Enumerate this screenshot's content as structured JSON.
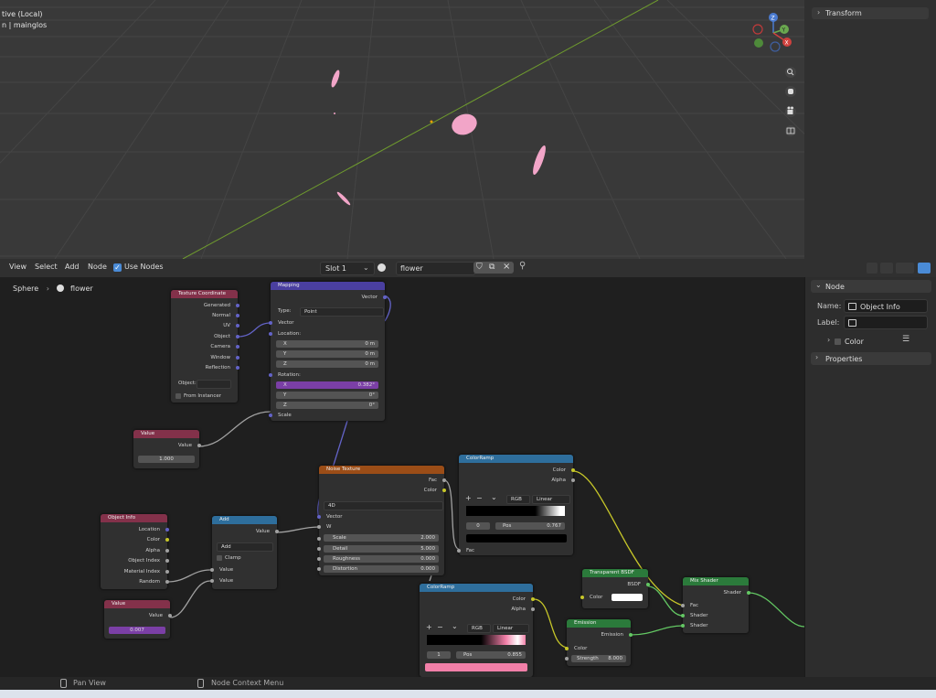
{
  "colors": {
    "grid_line": "#454545",
    "axis_green": "#6e9a2e",
    "petal": "#f2a5c8",
    "blue_sock": "#6363c7",
    "yellow_sock": "#c7c729",
    "gray_sock": "#a1a1a1",
    "green_sock": "#63c763",
    "purple_field": "#7b3fa6",
    "pink_ramp": "#f27fa8"
  },
  "viewport": {
    "mode_text": "tive (Local)",
    "object_text": "n | mainglos"
  },
  "right_panel_top": {
    "transform_label": "Transform"
  },
  "gizmo": {
    "z": "Z",
    "y": "Y",
    "x": "X"
  },
  "header": {
    "view": "View",
    "select": "Select",
    "add": "Add",
    "node": "Node",
    "use_nodes": "Use Nodes",
    "slot": "Slot 1",
    "material": "flower"
  },
  "breadcrumb": {
    "object": "Sphere",
    "material": "flower"
  },
  "side_panel": {
    "node_tab": "Node",
    "name_label": "Name:",
    "name_value": "Object Info",
    "label_label": "Label:",
    "color_label": "Color",
    "properties_label": "Properties"
  },
  "nodes": {
    "texcoord": {
      "title": "Texture Coordinate",
      "outputs": [
        "Generated",
        "Normal",
        "UV",
        "Object",
        "Camera",
        "Window",
        "Reflection"
      ],
      "object_label": "Object:",
      "from_instancer": "From Instancer"
    },
    "mapping": {
      "title": "Mapping",
      "out_vector": "Vector",
      "type_label": "Type:",
      "type_value": "Point",
      "in_vector": "Vector",
      "location": "Location:",
      "loc": [
        {
          "a": "X",
          "v": "0 m"
        },
        {
          "a": "Y",
          "v": "0 m"
        },
        {
          "a": "Z",
          "v": "0 m"
        }
      ],
      "rotation": "Rotation:",
      "rot": [
        {
          "a": "X",
          "v": "0.382°"
        },
        {
          "a": "Y",
          "v": "0°"
        },
        {
          "a": "Z",
          "v": "0°"
        }
      ],
      "scale": "Scale"
    },
    "value1": {
      "title": "Value",
      "out": "Value",
      "val": "1.000"
    },
    "noise": {
      "title": "Noise Texture",
      "fac": "Fac",
      "color": "Color",
      "dim": "4D",
      "vector": "Vector",
      "w": "W",
      "fields": [
        {
          "a": "Scale",
          "v": "2.000"
        },
        {
          "a": "Detail",
          "v": "5.000"
        },
        {
          "a": "Roughness",
          "v": "0.000"
        },
        {
          "a": "Distortion",
          "v": "0.000"
        }
      ]
    },
    "ramp1": {
      "title": "ColorRamp",
      "color": "Color",
      "alpha": "Alpha",
      "mode": "RGB",
      "interp": "Linear",
      "idx": "0",
      "pos_label": "Pos",
      "pos_val": "0.767",
      "fac": "Fac"
    },
    "objinfo": {
      "title": "Object Info",
      "outputs": [
        "Location",
        "Color",
        "Alpha",
        "Object Index",
        "Material Index",
        "Random"
      ]
    },
    "add": {
      "title": "Add",
      "out": "Value",
      "op": "Add",
      "clamp": "Clamp",
      "in1": "Value",
      "in2": "Value"
    },
    "value2": {
      "title": "Value",
      "out": "Value",
      "val": "0.007"
    },
    "ramp2": {
      "title": "ColorRamp",
      "color": "Color",
      "alpha": "Alpha",
      "mode": "RGB",
      "interp": "Linear",
      "idx": "1",
      "pos_label": "Pos",
      "pos_val": "0.855"
    },
    "transparent": {
      "title": "Transparent BSDF",
      "out": "BSDF",
      "color": "Color"
    },
    "emission": {
      "title": "Emission",
      "out": "Emission",
      "color": "Color",
      "strength": "Strength",
      "strength_val": "8.000"
    },
    "mix": {
      "title": "Mix Shader",
      "out": "Shader",
      "fac": "Fac",
      "sh1": "Shader",
      "sh2": "Shader"
    }
  },
  "status": {
    "pan": "Pan View",
    "ctx": "Node Context Menu"
  }
}
